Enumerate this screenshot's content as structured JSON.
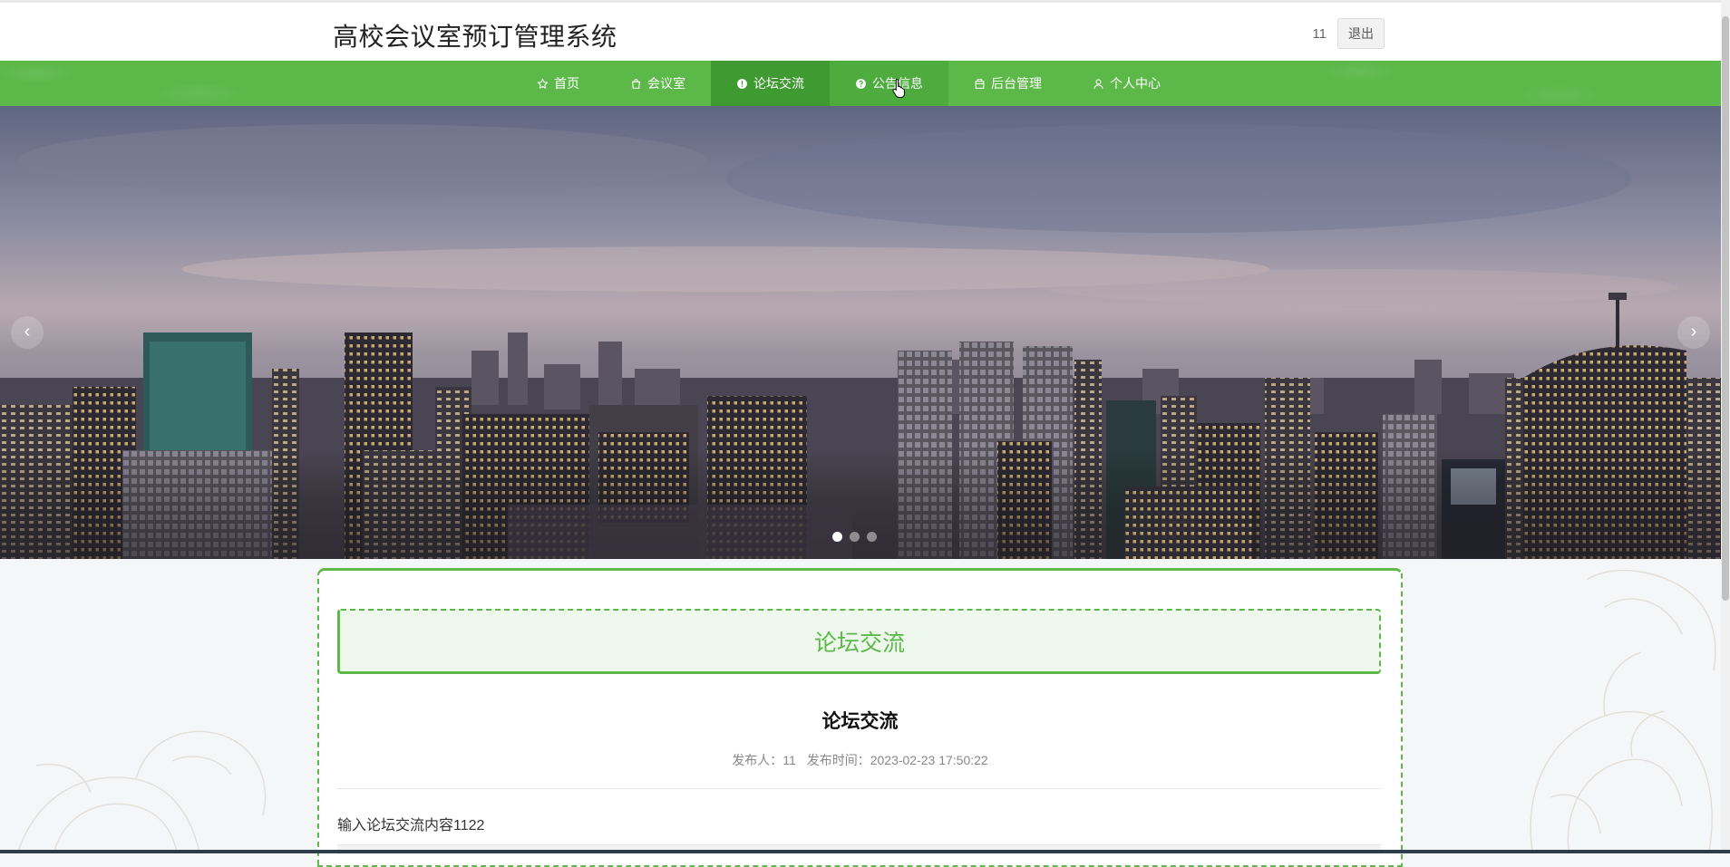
{
  "header": {
    "title": "高校会议室预订管理系统",
    "username": "11",
    "logout_label": "退出"
  },
  "nav": {
    "items": [
      {
        "label": "首页",
        "icon": "star-icon"
      },
      {
        "label": "会议室",
        "icon": "bag-icon"
      },
      {
        "label": "论坛交流",
        "icon": "exclamation-circle-icon"
      },
      {
        "label": "公告信息",
        "icon": "question-circle-icon"
      },
      {
        "label": "后台管理",
        "icon": "box-icon"
      },
      {
        "label": "个人中心",
        "icon": "user-icon"
      }
    ],
    "active_index": 2,
    "hover_index": 3
  },
  "banner": {
    "prev_label": "‹",
    "next_label": "›",
    "slide_count": 3,
    "active_slide": 1
  },
  "content": {
    "section_title": "论坛交流",
    "post_title": "论坛交流",
    "publisher_label": "发布人：",
    "publisher": "11",
    "time_label": "发布时间：",
    "publish_time": "2023-02-23 17:50:22",
    "body": "输入论坛交流内容1122"
  },
  "colors": {
    "brand_green": "#5cb849",
    "active_green": "#3f9a32"
  }
}
